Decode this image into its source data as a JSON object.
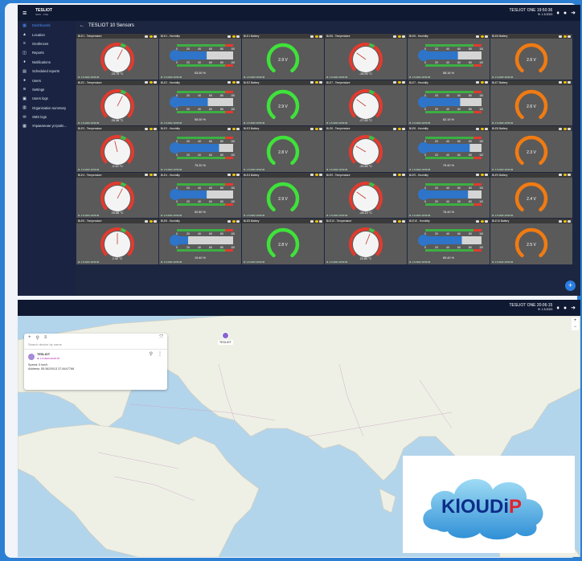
{
  "top": {
    "app_name": "TESLIOT",
    "app_sub": "NEW · ONE",
    "clock_title": "TESLIOT ONE 19:50:36",
    "clock_date": "Ф. 1.5.2023",
    "page_title": "TESLIOT 10 Sensors"
  },
  "sidebar": {
    "items": [
      {
        "label": "Dashboards",
        "icon": "dashboard-icon",
        "glyph": "▦"
      },
      {
        "label": "Location",
        "icon": "location-icon",
        "glyph": "▲"
      },
      {
        "label": "Geofences",
        "icon": "geofence-icon",
        "glyph": "≡"
      },
      {
        "label": "Reports",
        "icon": "reports-icon",
        "glyph": "◫"
      },
      {
        "label": "Notifications",
        "icon": "bell-icon",
        "glyph": "♦"
      },
      {
        "label": "Scheduled reports",
        "icon": "calendar-icon",
        "glyph": "▤"
      },
      {
        "label": "Users",
        "icon": "users-icon",
        "glyph": "●"
      },
      {
        "label": "Settings",
        "icon": "settings-icon",
        "glyph": "≋"
      },
      {
        "label": "Users logs",
        "icon": "log-icon",
        "glyph": "▣"
      },
      {
        "label": "Organization summary",
        "icon": "org-icon",
        "glyph": "▥"
      },
      {
        "label": "SMS logs",
        "icon": "sms-icon",
        "glyph": "✉"
      },
      {
        "label": "Управление устройс...",
        "icon": "device-icon",
        "glyph": "▦"
      }
    ]
  },
  "cards": [
    {
      "type": "temp",
      "title": "BLE1 - Temperature",
      "value": "25.78 °C",
      "date": "Ф. 1.5.2023 19:50:36",
      "pct": 0.6
    },
    {
      "type": "hum",
      "title": "BLE1 - Humidity",
      "value": "53.00 %",
      "date": "Ф. 1.5.2023 19:50:36",
      "pct": 0.53
    },
    {
      "type": "bat",
      "title": "BLE1 Battery",
      "value": "2.9 V",
      "date": "Ф. 1.5.2023 19:50:36",
      "color": "#3fe23a"
    },
    {
      "type": "temp",
      "title": "BLE6 - Temperature",
      "value": "-28.90 °C",
      "date": "Ф. 1.5.2023 19:50:36",
      "pct": 0.3
    },
    {
      "type": "hum",
      "title": "BLE6 - Humidity",
      "value": "58.16 %",
      "date": "Ф. 1.5.2023 19:50:36",
      "pct": 0.58
    },
    {
      "type": "bat",
      "title": "BLE6 Battery",
      "value": "2.6 V",
      "date": "Ф. 1.5.2023 19:50:36",
      "color": "#f07b12"
    },
    {
      "type": "temp",
      "title": "BLE2 - Temperature",
      "value": "26.38 °C",
      "date": "Ф. 1.5.2023 19:50:36",
      "pct": 0.6
    },
    {
      "type": "hum",
      "title": "BLE2 - Humidity",
      "value": "55.00 %",
      "date": "Ф. 1.5.2023 19:50:36",
      "pct": 0.55
    },
    {
      "type": "bat",
      "title": "BLE2 Battery",
      "value": "2.9 V",
      "date": "Ф. 1.5.2023 19:50:36",
      "color": "#3fe23a"
    },
    {
      "type": "temp",
      "title": "BLE7 - Temperature",
      "value": "-27.60 °C",
      "date": "Ф. 1.5.2023 19:50:36",
      "pct": 0.3
    },
    {
      "type": "hum",
      "title": "BLE7 - Humidity",
      "value": "62.19 %",
      "date": "Ф. 1.5.2023 19:50:36",
      "pct": 0.62
    },
    {
      "type": "bat",
      "title": "BLE7 Battery",
      "value": "2.6 V",
      "date": "Ф. 1.5.2023 19:50:36",
      "color": "#f07b12"
    },
    {
      "type": "temp",
      "title": "BLE3 - Temperature",
      "value": "-0.10 °C",
      "date": "Ф. 1.5.2023 19:50:36",
      "pct": 0.45
    },
    {
      "type": "hum",
      "title": "BLE3 - Humidity",
      "value": "75.20 %",
      "date": "Ф. 1.5.2023 19:50:36",
      "pct": 0.75
    },
    {
      "type": "bat",
      "title": "BLE3 Battery",
      "value": "2.8 V",
      "date": "Ф. 1.5.2023 19:50:36",
      "color": "#3fe23a"
    },
    {
      "type": "temp",
      "title": "BLE8 - Temperature",
      "value": "-31.60 °C",
      "date": "Ф. 1.5.2023 19:50:36",
      "pct": 0.28
    },
    {
      "type": "hum",
      "title": "BLE8 - Humidity",
      "value": "79.40 %",
      "date": "Ф. 1.5.2023 19:50:36",
      "pct": 0.79
    },
    {
      "type": "bat",
      "title": "BLE8 Battery",
      "value": "2.3 V",
      "date": "Ф. 1.5.2023 19:50:36",
      "color": "#f07b12"
    },
    {
      "type": "temp",
      "title": "BLE4 - Temperature",
      "value": "25.68 °C",
      "date": "Ф. 1.5.2023 19:50:36",
      "pct": 0.6
    },
    {
      "type": "hum",
      "title": "BLE4 - Humidity",
      "value": "52.80 %",
      "date": "Ф. 1.5.2023 19:50:36",
      "pct": 0.53
    },
    {
      "type": "bat",
      "title": "BLE4 Battery",
      "value": "2.9 V",
      "date": "Ф. 1.5.2023 19:50:36",
      "color": "#3fe23a"
    },
    {
      "type": "temp",
      "title": "BLE9 - Temperature",
      "value": "-28.10 °C",
      "date": "Ф. 1.5.2023 19:50:36",
      "pct": 0.3
    },
    {
      "type": "hum",
      "title": "BLE9 - Humidity",
      "value": "76.40 %",
      "date": "Ф. 1.5.2023 19:50:36",
      "pct": 0.76
    },
    {
      "type": "bat",
      "title": "BLE9 Battery",
      "value": "2.4 V",
      "date": "Ф. 1.5.2023 19:50:36",
      "color": "#f07b12"
    },
    {
      "type": "temp",
      "title": "BLE5 - Temperature",
      "value": "2.40 °C",
      "date": "Ф. 1.5.2023 19:50:36",
      "pct": 0.5
    },
    {
      "type": "hum",
      "title": "BLE5 - Humidity",
      "value": "19.60 %",
      "date": "Ф. 1.5.2023 19:50:36",
      "pct": 0.2
    },
    {
      "type": "bat",
      "title": "BLE5 Battery",
      "value": "2.8 V",
      "date": "Ф. 1.5.2023 19:50:36",
      "color": "#3fe23a"
    },
    {
      "type": "temp",
      "title": "BLE10 - Temperature",
      "value": "23.80 °C",
      "date": "Ф. 1.5.2023 19:50:36",
      "pct": 0.58
    },
    {
      "type": "hum",
      "title": "BLE10 - Humidity",
      "value": "65.40 %",
      "date": "Ф. 1.5.2023 19:50:36",
      "pct": 0.65
    },
    {
      "type": "bat",
      "title": "BLE10 Battery",
      "value": "2.5 V",
      "date": "Ф. 1.5.2023 19:50:36",
      "color": "#f07b12"
    }
  ],
  "hum_scale": [
    "0",
    "20",
    "40",
    "60",
    "80",
    "100"
  ],
  "map": {
    "clock_title": "TESLIOT ONE 20:06:15",
    "clock_date": "Ф. 1.5.2023",
    "search_placeholder": "Search device by name",
    "device_name": "TESLIOT",
    "device_date": "Ф. 1.5.2023 20:06:15",
    "speed": "Speed: 0 km/h",
    "address": "Address: 55.5620013 37.8447766",
    "pin_label": "TESLIOT",
    "zoom_in": "+",
    "zoom_out": "−"
  },
  "fab": "+",
  "logo": {
    "text_main": "KlOUDi",
    "text_accent": "P",
    "brand_blue": "#1f6fd0",
    "brand_red": "#e3222b"
  }
}
